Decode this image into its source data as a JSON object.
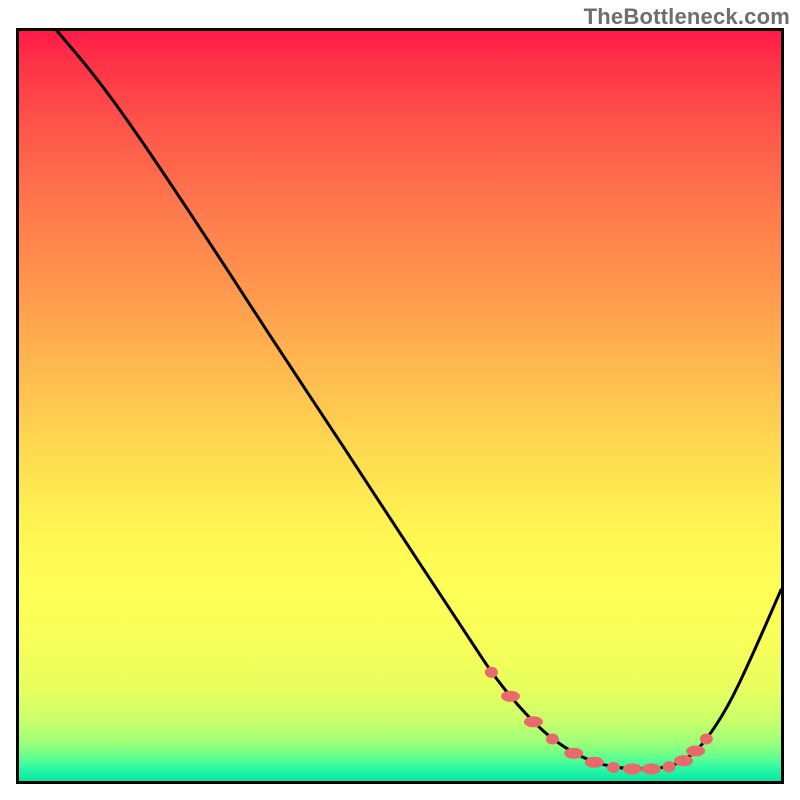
{
  "watermark": "TheBottleneck.com",
  "colors": {
    "border": "#000000",
    "curve": "#000000",
    "dots": "#e86a6a",
    "watermark_text": "#6e6e6e",
    "gradient_top": "#ff1a49",
    "gradient_bottom": "#08e6a0"
  },
  "chart_data": {
    "type": "line",
    "title": "",
    "xlabel": "",
    "ylabel": "",
    "xlim": [
      0,
      100
    ],
    "ylim": [
      0,
      100
    ],
    "grid": false,
    "legend": false,
    "note": "Axes carry no numeric tick labels in the image; values are normalized 0-100 estimates read from pixel positions. Lower y values correspond to positions nearer the bottom (green) band.",
    "series": [
      {
        "name": "curve",
        "x": [
          5,
          10,
          15,
          20,
          25,
          30,
          35,
          40,
          45,
          50,
          55,
          60,
          62,
          65,
          68,
          70,
          73,
          76,
          79,
          82,
          84,
          86,
          88,
          90,
          93,
          96,
          100
        ],
        "y": [
          100,
          94,
          87,
          79.5,
          71.8,
          64,
          56.2,
          48.5,
          40.8,
          33,
          25.3,
          17.6,
          14.5,
          10.6,
          7.4,
          5.6,
          3.6,
          2.3,
          1.7,
          1.6,
          1.7,
          2.1,
          3.2,
          5.2,
          9.8,
          16.2,
          25.5
        ]
      }
    ],
    "highlight_points": {
      "name": "bottom-dots",
      "description": "Salmon dots and dashes along the valley/minimum region of the curve (approx x 62–90).",
      "x": [
        62,
        64.5,
        67.5,
        70,
        72.8,
        75.5,
        78,
        80.5,
        83,
        85.3,
        87.2,
        88.8,
        90.2
      ],
      "y": [
        14.5,
        11.3,
        7.9,
        5.6,
        3.7,
        2.5,
        1.8,
        1.6,
        1.6,
        1.9,
        2.7,
        4.0,
        5.6
      ]
    }
  }
}
